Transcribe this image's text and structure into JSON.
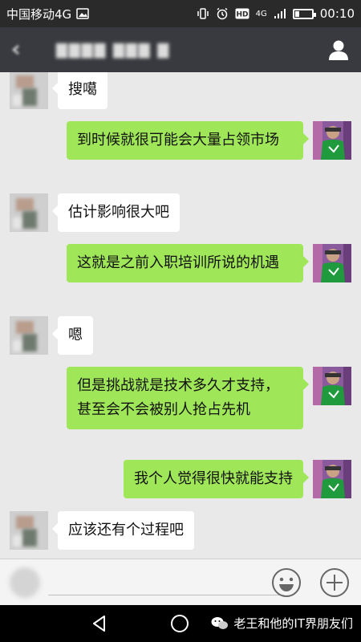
{
  "status_bar": {
    "carrier": "中国移动4G",
    "network": "4G",
    "time": "00:10",
    "battery_level": 0.25
  },
  "title_bar": {
    "back_icon": "back-icon",
    "contact_icon": "person-icon"
  },
  "messages": [
    {
      "side": "in",
      "text": "搜噶"
    },
    {
      "side": "out",
      "text": "到时候就很可能会大量占领市场"
    },
    {
      "side": "in",
      "text": "估计影响很大吧"
    },
    {
      "side": "out",
      "text": "这就是之前入职培训所说的机遇"
    },
    {
      "side": "in",
      "text": "嗯"
    },
    {
      "side": "out",
      "text": "但是挑战就是技术多久才支持，甚至会不会被别人抢占先机"
    },
    {
      "side": "out",
      "text": "我个人觉得很快就能支持"
    },
    {
      "side": "in",
      "text": "应该还有个过程吧"
    }
  ],
  "input_bar": {
    "emoji_icon": "emoji-icon",
    "plus_icon": "plus-icon"
  },
  "nav_bar": {
    "watermark": "老王和他的IT界朋友们"
  },
  "colors": {
    "status_bar": "#2a2a2a",
    "title_bar": "#393a3f",
    "chat_bg": "#e9e9e9",
    "bubble_out": "#9fe658",
    "bubble_in": "#ffffff"
  }
}
